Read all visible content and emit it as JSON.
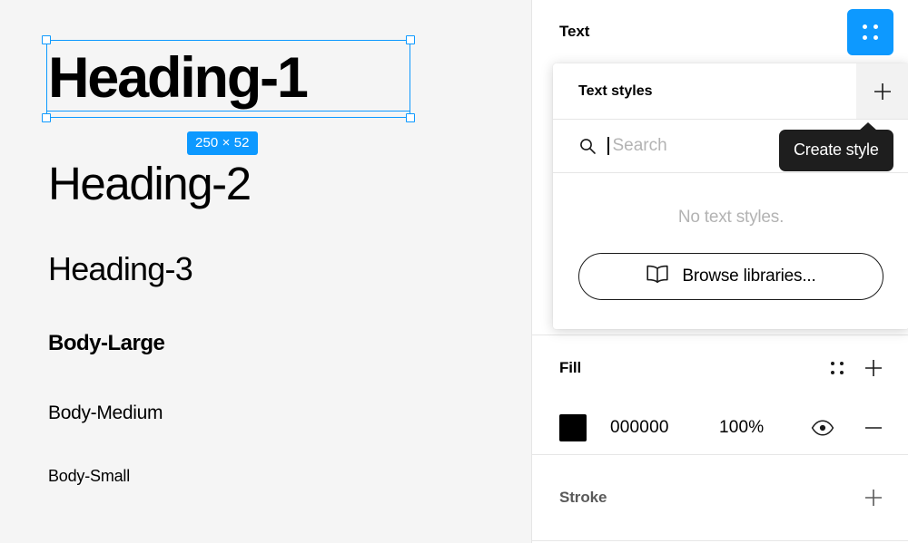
{
  "canvas": {
    "background_color": "#F5F5F5",
    "text_samples": [
      {
        "label": "Heading-1",
        "name": "heading-1-sample"
      },
      {
        "label": "Heading-2",
        "name": "heading-2-sample"
      },
      {
        "label": "Heading-3",
        "name": "heading-3-sample"
      },
      {
        "label": "Body-Large",
        "name": "body-large-sample"
      },
      {
        "label": "Body-Medium",
        "name": "body-medium-sample"
      },
      {
        "label": "Body-Small",
        "name": "body-small-sample"
      }
    ],
    "selection": {
      "accent_color": "#0D99FF",
      "size_badge": "250 × 52",
      "width": "250",
      "height": "52",
      "selected_layer": "Heading-1"
    }
  },
  "panel": {
    "header": {
      "title": "Text",
      "style_toggle_icon": "four-dot-grid-icon",
      "style_toggle_color": "#0D99FF"
    },
    "styles_dropdown": {
      "title": "Text styles",
      "create_icon": "plus-icon",
      "search": {
        "placeholder": "Search",
        "value": "",
        "icon": "search-icon"
      },
      "empty_message": "No text styles.",
      "browse_button": {
        "label": "Browse libraries...",
        "icon": "book-icon"
      }
    },
    "tooltip": {
      "text": "Create style",
      "background_color": "#1E1E1E"
    },
    "fill": {
      "title": "Fill",
      "styles_icon": "four-dot-grid-icon",
      "add_icon": "plus-icon",
      "rows": [
        {
          "swatch_color": "#000000",
          "hex": "000000",
          "opacity": "100%",
          "visibility_icon": "eye-icon",
          "remove_icon": "minus-icon"
        }
      ]
    },
    "stroke": {
      "title": "Stroke",
      "add_icon": "plus-icon"
    }
  }
}
